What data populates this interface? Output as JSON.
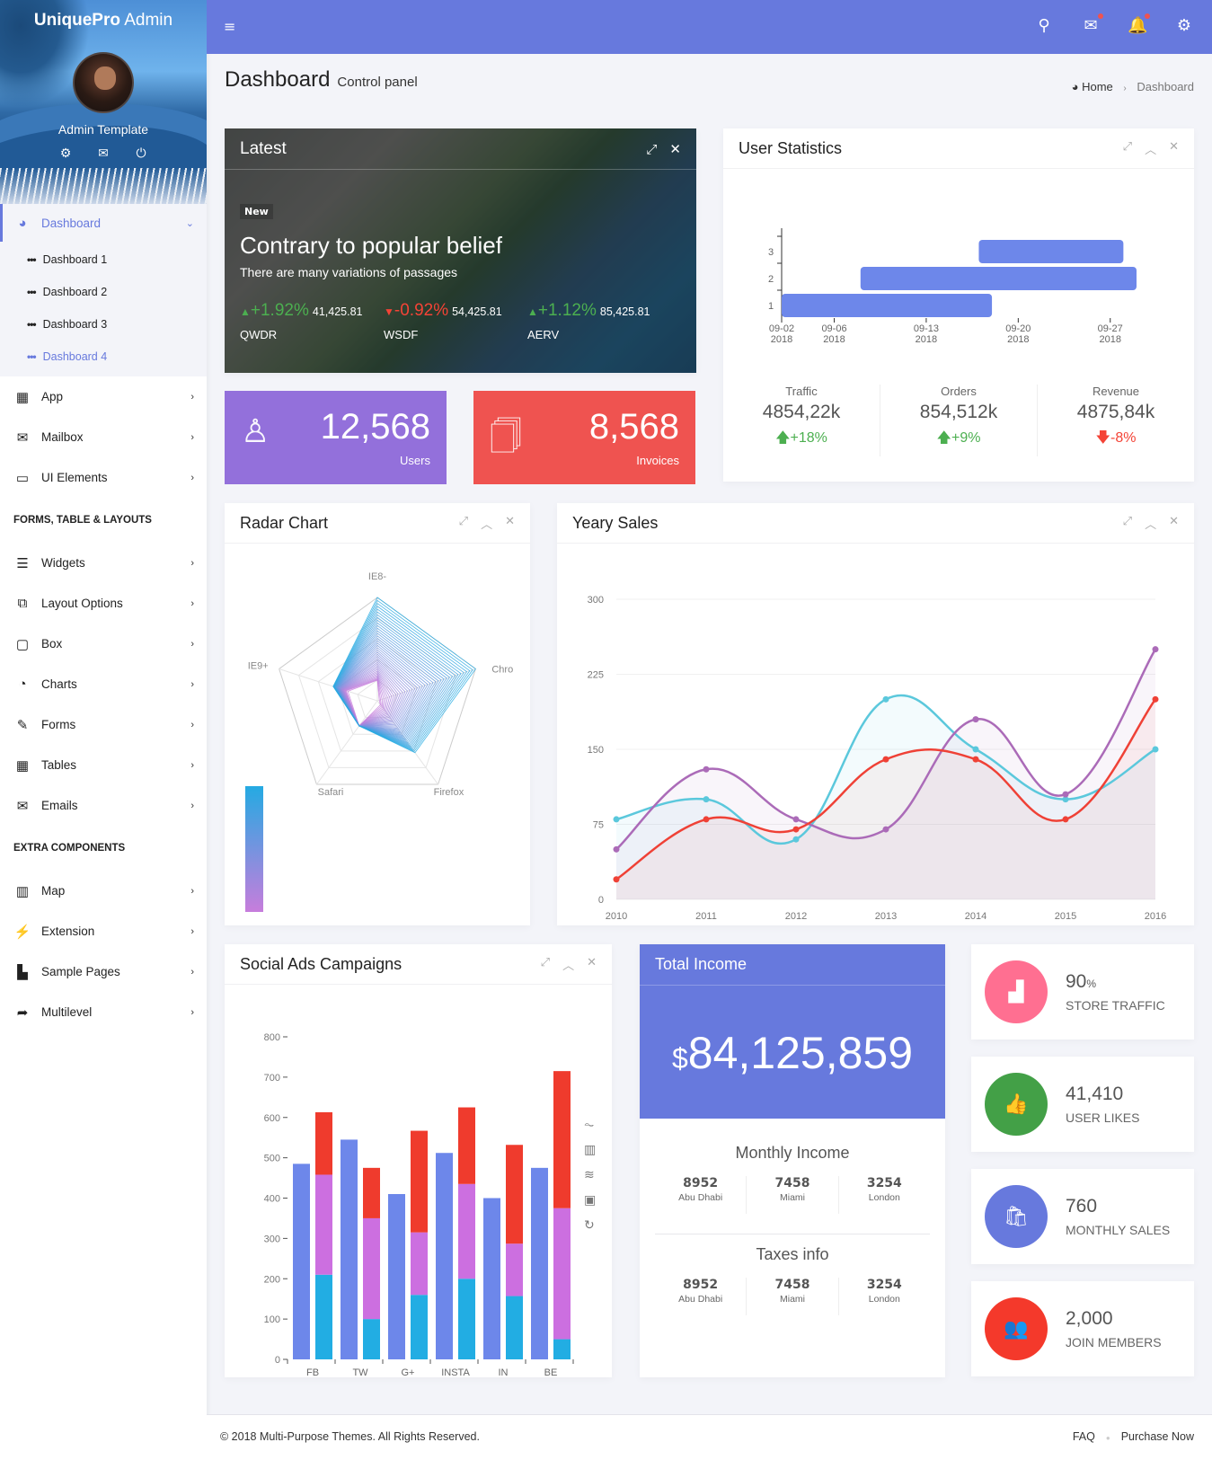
{
  "brand": {
    "bold": "UniquePro",
    "light": " Admin"
  },
  "sidebar": {
    "user_name": "Admin Template",
    "user_links": [
      {
        "icon": "gear-icon",
        "glyph": "⚙"
      },
      {
        "icon": "mail-icon",
        "glyph": "✉"
      },
      {
        "icon": "power-icon",
        "glyph": "⏻"
      }
    ],
    "dashboard": {
      "label": "Dashboard",
      "glyph": "◕"
    },
    "dashboard_subitems": [
      {
        "label": "Dashboard 1"
      },
      {
        "label": "Dashboard 2"
      },
      {
        "label": "Dashboard 3"
      },
      {
        "label": "Dashboard 4"
      }
    ],
    "items_main": [
      {
        "label": "App",
        "glyph": "▦",
        "icon": "apps-grid-icon"
      },
      {
        "label": "Mailbox",
        "glyph": "✉",
        "icon": "envelope-icon"
      },
      {
        "label": "UI Elements",
        "glyph": "▭",
        "icon": "laptop-icon"
      }
    ],
    "section_forms": "FORMS, TABLE & LAYOUTS",
    "items_forms": [
      {
        "label": "Widgets",
        "glyph": "☰",
        "icon": "bars-icon"
      },
      {
        "label": "Layout Options",
        "glyph": "⧉",
        "icon": "copy-icon"
      },
      {
        "label": "Box",
        "glyph": "▢",
        "icon": "square-icon"
      },
      {
        "label": "Charts",
        "glyph": "◔",
        "icon": "pie-chart-icon"
      },
      {
        "label": "Forms",
        "glyph": "✎",
        "icon": "edit-icon"
      },
      {
        "label": "Tables",
        "glyph": "▦",
        "icon": "table-icon"
      },
      {
        "label": "Emails",
        "glyph": "✉",
        "icon": "envelope-open-icon"
      }
    ],
    "section_extra": "EXTRA COMPONENTS",
    "items_extra": [
      {
        "label": "Map",
        "glyph": "▥",
        "icon": "map-icon"
      },
      {
        "label": "Extension",
        "glyph": "⚡",
        "icon": "plug-icon"
      },
      {
        "label": "Sample Pages",
        "glyph": "▙",
        "icon": "file-icon"
      },
      {
        "label": "Multilevel",
        "glyph": "➦",
        "icon": "share-icon"
      }
    ],
    "chevron": "›"
  },
  "topbar": {
    "toggle": "≡",
    "icons": [
      {
        "name": "search-icon",
        "glyph": "⚲",
        "badge": false
      },
      {
        "name": "mail-icon",
        "glyph": "✉",
        "badge": true
      },
      {
        "name": "bell-icon",
        "glyph": "🔔",
        "badge": true
      },
      {
        "name": "settings-icon",
        "glyph": "⚙",
        "badge": false
      }
    ]
  },
  "page": {
    "title": "Dashboard",
    "subtitle": "Control panel",
    "breadcrumb": {
      "home": "Home",
      "current": "Dashboard",
      "home_glyph": "◕",
      "sep": "›"
    }
  },
  "latest": {
    "title": "Latest",
    "badge": "New",
    "headline": "Contrary to popular belief",
    "sub": "There are many variations of passages",
    "tickers": [
      {
        "dir": "up",
        "arrow": "▲",
        "pct": "+1.92%",
        "value": "41,425.81",
        "symbol": "QWDR"
      },
      {
        "dir": "dn",
        "arrow": "▼",
        "pct": "-0.92%",
        "value": "54,425.81",
        "symbol": "WSDF"
      },
      {
        "dir": "up",
        "arrow": "▲",
        "pct": "+1.12%",
        "value": "85,425.81",
        "symbol": "AERV"
      }
    ]
  },
  "stats": [
    {
      "value": "12,568",
      "label": "Users",
      "color": "#9370db",
      "glyph": "♙"
    },
    {
      "value": "8,568",
      "label": "Invoices",
      "color": "#ef5350",
      "glyph": "🗍"
    }
  ],
  "tools": {
    "expand": "⤢",
    "collapse": "︿",
    "close": "✕"
  },
  "user_statistics": {
    "title": "User Statistics",
    "summary": [
      {
        "label": "Traffic",
        "value": "4854,22k",
        "change": "+18%",
        "dir": "up",
        "arrow": "🡅"
      },
      {
        "label": "Orders",
        "value": "854,512k",
        "change": "+9%",
        "dir": "up",
        "arrow": "🡅"
      },
      {
        "label": "Revenue",
        "value": "4875,84k",
        "change": "-8%",
        "dir": "dn",
        "arrow": "🡇"
      }
    ]
  },
  "radar": {
    "title": "Radar Chart"
  },
  "yearly": {
    "title": "Yeary Sales"
  },
  "social": {
    "title": "Social Ads Campaigns",
    "toolbox": [
      "line-chart-icon",
      "bar-chart-icon",
      "stack-icon",
      "tiled-icon",
      "restore-icon"
    ]
  },
  "income": {
    "title": "Total Income",
    "currency": "$",
    "amount": "84,125,859",
    "monthly": {
      "title": "Monthly Income",
      "cols": [
        {
          "v": "8952",
          "l": "Abu Dhabi"
        },
        {
          "v": "7458",
          "l": "Miami"
        },
        {
          "v": "3254",
          "l": "London"
        }
      ]
    },
    "taxes": {
      "title": "Taxes info",
      "cols": [
        {
          "v": "8952",
          "l": "Abu Dhabi"
        },
        {
          "v": "7458",
          "l": "Miami"
        },
        {
          "v": "3254",
          "l": "London"
        }
      ]
    }
  },
  "info_boxes": [
    {
      "value": "90",
      "unit": "%",
      "label": "STORE TRAFFIC",
      "color": "#ff6f91",
      "glyph": "▟",
      "icon": "bar-chart-icon"
    },
    {
      "value": "41,410",
      "unit": "",
      "label": "USER LIKES",
      "color": "#43a047",
      "glyph": "👍",
      "icon": "thumbs-up-icon"
    },
    {
      "value": "760",
      "unit": "",
      "label": "MONTHLY SALES",
      "color": "#6779dd",
      "glyph": "🛍",
      "icon": "shopping-bag-icon"
    },
    {
      "value": "2,000",
      "unit": "",
      "label": "JOIN MEMBERS",
      "color": "#f4392b",
      "glyph": "👥",
      "icon": "users-icon"
    }
  ],
  "footer": {
    "copyright": "© 2018 Multi-Purpose Themes. All Rights Reserved.",
    "links": [
      "FAQ",
      "Purchase Now"
    ]
  },
  "chart_data": [
    {
      "type": "bar",
      "id": "user-statistics",
      "subtype": "timeline-range",
      "categories": [
        "1",
        "2",
        "3"
      ],
      "ranges": [
        {
          "row": "1",
          "start": "2018-09-02",
          "end": "2018-09-18"
        },
        {
          "row": "2",
          "start": "2018-09-08",
          "end": "2018-09-29"
        },
        {
          "row": "3",
          "start": "2018-09-17",
          "end": "2018-09-28"
        }
      ],
      "x_ticks": [
        "09-02 2018",
        "09-06 2018",
        "09-13 2018",
        "09-20 2018",
        "09-27 2018"
      ],
      "color": "#6d87ea"
    },
    {
      "type": "radar",
      "id": "radar-chart",
      "indicators": [
        "IE8-",
        "Chrome",
        "Firefox",
        "Safari",
        "IE9+"
      ],
      "series_note": "many overlapping gradient series from purple to cyan",
      "max": 1,
      "outer_series": {
        "IE8-": 1.0,
        "Chrome": 1.0,
        "Firefox": 0.62,
        "Safari": 0.3,
        "IE9+": 0.45
      },
      "inner_series": {
        "IE8-": 0.2,
        "Chrome": 0.02,
        "Firefox": 0.05,
        "Safari": 0.3,
        "IE9+": 0.3
      },
      "visual_map": {
        "colors": [
          "#c77ddc",
          "#24aae2"
        ]
      }
    },
    {
      "type": "area",
      "id": "yearly-sales",
      "x": [
        "2010",
        "2011",
        "2012",
        "2013",
        "2014",
        "2015",
        "2016"
      ],
      "ylim": [
        0,
        300
      ],
      "yticks": [
        0,
        75,
        150,
        225,
        300
      ],
      "series": [
        {
          "name": "cyan",
          "color": "#5bc8dc",
          "values": [
            80,
            100,
            60,
            200,
            150,
            100,
            150
          ]
        },
        {
          "name": "purple",
          "color": "#ab6bb8",
          "values": [
            50,
            130,
            80,
            70,
            180,
            105,
            250
          ]
        },
        {
          "name": "red",
          "color": "#ef4136",
          "values": [
            20,
            80,
            70,
            140,
            140,
            80,
            200
          ]
        }
      ]
    },
    {
      "type": "bar",
      "id": "social-ads",
      "categories": [
        "FB",
        "TW",
        "G+",
        "INSTA",
        "IN",
        "BE"
      ],
      "ylim": [
        0,
        800
      ],
      "yticks": [
        0,
        100,
        200,
        300,
        400,
        500,
        600,
        700,
        800
      ],
      "series": [
        {
          "name": "single",
          "color": "#6d87ea",
          "values": [
            485,
            545,
            410,
            512,
            400,
            475
          ]
        },
        {
          "name": "stack-cyan",
          "color": "#22ade3",
          "values": [
            210,
            100,
            160,
            200,
            157,
            50
          ]
        },
        {
          "name": "stack-purple",
          "color": "#cc6fe0",
          "values": [
            248,
            250,
            155,
            235,
            130,
            325
          ]
        },
        {
          "name": "stack-red",
          "color": "#ef3b2d",
          "values": [
            155,
            125,
            252,
            190,
            245,
            340
          ]
        }
      ]
    }
  ]
}
